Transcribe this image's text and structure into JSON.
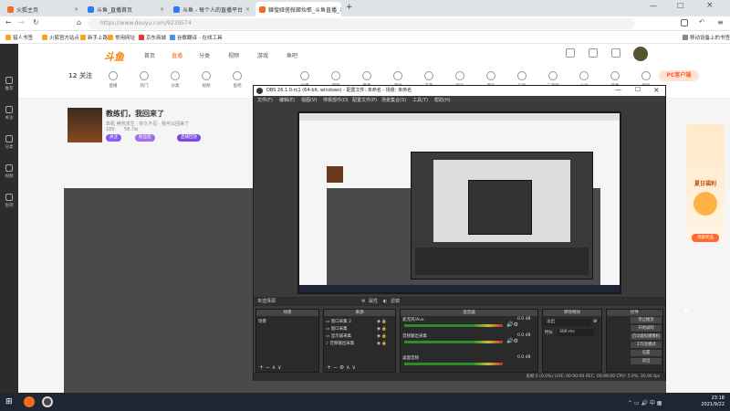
{
  "browser": {
    "tabs": [
      {
        "label": "火狐主页"
      },
      {
        "label": "斗鱼_直播首页"
      },
      {
        "label": "斗鱼 - 每个人的直播平台"
      },
      {
        "label": "鍊偟娅傞敍鍥炲悵_斗鱼直播_斗鱼"
      }
    ],
    "url": "https://www.douyu.com/9239574",
    "bookmarks": [
      "猎人书签",
      "火狐官方站点",
      "新手上路",
      "常用网址",
      "京东商城",
      "谷歌翻译 - 在线工具"
    ],
    "mobile_bookmarks": "移动设备上的书签"
  },
  "site": {
    "logo": "斗鱼",
    "nav": [
      "首页",
      "直播",
      "分类",
      "视频",
      "游戏",
      "鱼吧"
    ],
    "left_nav": [
      "推荐",
      "关注",
      "分类",
      "视频",
      "鱼吧"
    ],
    "categories": [
      "12 关注",
      "直播",
      "热门",
      "分类",
      "视频",
      "鱼吧",
      "主播",
      "游戏",
      "赛事",
      "活动",
      "下载",
      "娱乐",
      "音乐",
      "户外",
      "二次元",
      "公益",
      "新秀",
      "颜值"
    ],
    "pc_button": "PC客户端",
    "room": {
      "title": "教练们，我回来了",
      "meta": "单机  绝地求生 · 好久不见 · 我可以回来了",
      "fans": "180",
      "views": "58.7w",
      "chips": [
        "关注",
        "粉丝团",
        "直播回放"
      ]
    },
    "promo": {
      "title": "夏日福利",
      "button": "领取奖品"
    }
  },
  "obs": {
    "title": "OBS 26.1.0-rc1 (64-bit, windows) - 配置文件: 未命名 - 场景: 未命名",
    "menu": [
      "文件(F)",
      "编辑(E)",
      "视图(V)",
      "停靠部件(D)",
      "配置文件(P)",
      "场景集合(S)",
      "工具(T)",
      "帮助(H)"
    ],
    "scene_bar": {
      "label": "未选择源",
      "props": "属性",
      "filters": "滤镜"
    },
    "docks": {
      "scenes": {
        "title": "场景",
        "items": [
          "场景"
        ]
      },
      "sources": {
        "title": "来源",
        "items": [
          "窗口采集 2",
          "窗口采集",
          "显示器采集",
          "音频输出采集"
        ]
      },
      "mixer": {
        "title": "混音器",
        "tracks": [
          {
            "name": "麦克风/Aux",
            "level": "0.0 dB"
          },
          {
            "name": "音频输出采集",
            "level": "0.0 dB"
          },
          {
            "name": "桌面音频",
            "level": "0.0 dB"
          }
        ]
      },
      "transitions": {
        "title": "转场特效",
        "type": "淡出",
        "duration_label": "时长",
        "duration": "300 ms"
      },
      "controls": {
        "title": "控件",
        "buttons": [
          "停止推流",
          "开始录制",
          "启动虚拟摄像机",
          "工作室模式",
          "设置",
          "退出"
        ]
      }
    },
    "status": "丢帧 0 (0.0%)   LIVE: 00:00:00   REC: 00:00:00   CPU: 5.0%, 30.00 fps"
  },
  "taskbar": {
    "time": "23:18",
    "date": "2021/9/22"
  },
  "colors": {
    "accent": "#ff5d23",
    "obs_bg": "#3a3a3a",
    "taskbar": "#1f2633"
  }
}
